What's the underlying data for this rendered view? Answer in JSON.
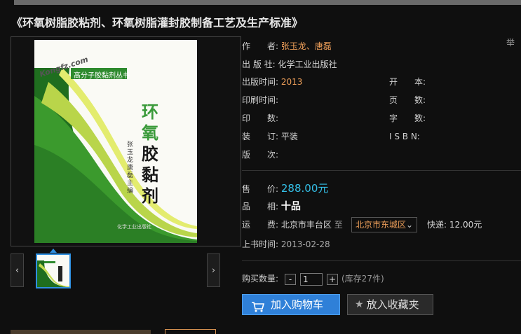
{
  "title": "《环氧树脂胶粘剂、环氧树脂灌封胶制备工艺及生产标准》",
  "corner_mark": "举",
  "cover": {
    "brand": "Kongfz.com",
    "series": "高分子胶黏剂丛书",
    "title_chars": [
      "环",
      "氧",
      "胶",
      "黏",
      "剂"
    ],
    "authors": "张玉龙  唐磊  主编",
    "publisher_small": "化学工业出版社"
  },
  "nav": {
    "prev": "‹",
    "next": "›"
  },
  "fields": {
    "author_label": "作　　者:",
    "author_1": "张玉龙",
    "author_sep": "、",
    "author_2": "唐磊",
    "publisher_label": "出 版 社:",
    "publisher": "化学工业出版社",
    "pubdate_label": "出版时间:",
    "pubdate": "2013",
    "format_label": "开　　本:",
    "print_time_label": "印刷时间:",
    "pages_label": "页　　数:",
    "impression_label": "印　　数:",
    "words_label": "字　　数:",
    "binding_label": "装　　订:",
    "binding": "平装",
    "isbn_label": "I S B N:",
    "edition_label": "版　　次:"
  },
  "sale": {
    "price_label": "售　　价:",
    "price": "288.00元",
    "condition_label": "品　　相:",
    "condition": "十品",
    "shipping_label": "运　　费:",
    "ship_from": "北京市丰台区",
    "ship_to_word": "至",
    "ship_to": "北京市东城区",
    "express_label": "快递:",
    "express_fee": "12.00元",
    "listed_label": "上书时间:",
    "listed": "2013-02-28"
  },
  "purchase": {
    "qty_label": "购买数量:",
    "minus": "-",
    "qty": "1",
    "plus": "+",
    "stock": "(库存27件)",
    "add_cart": "加入购物车",
    "add_fav": "放入收藏夹"
  },
  "colors": {
    "accent": "#2f80d8",
    "price": "#34c0e8",
    "link": "#f0a05a",
    "cover_green": "#2e8a2e"
  }
}
